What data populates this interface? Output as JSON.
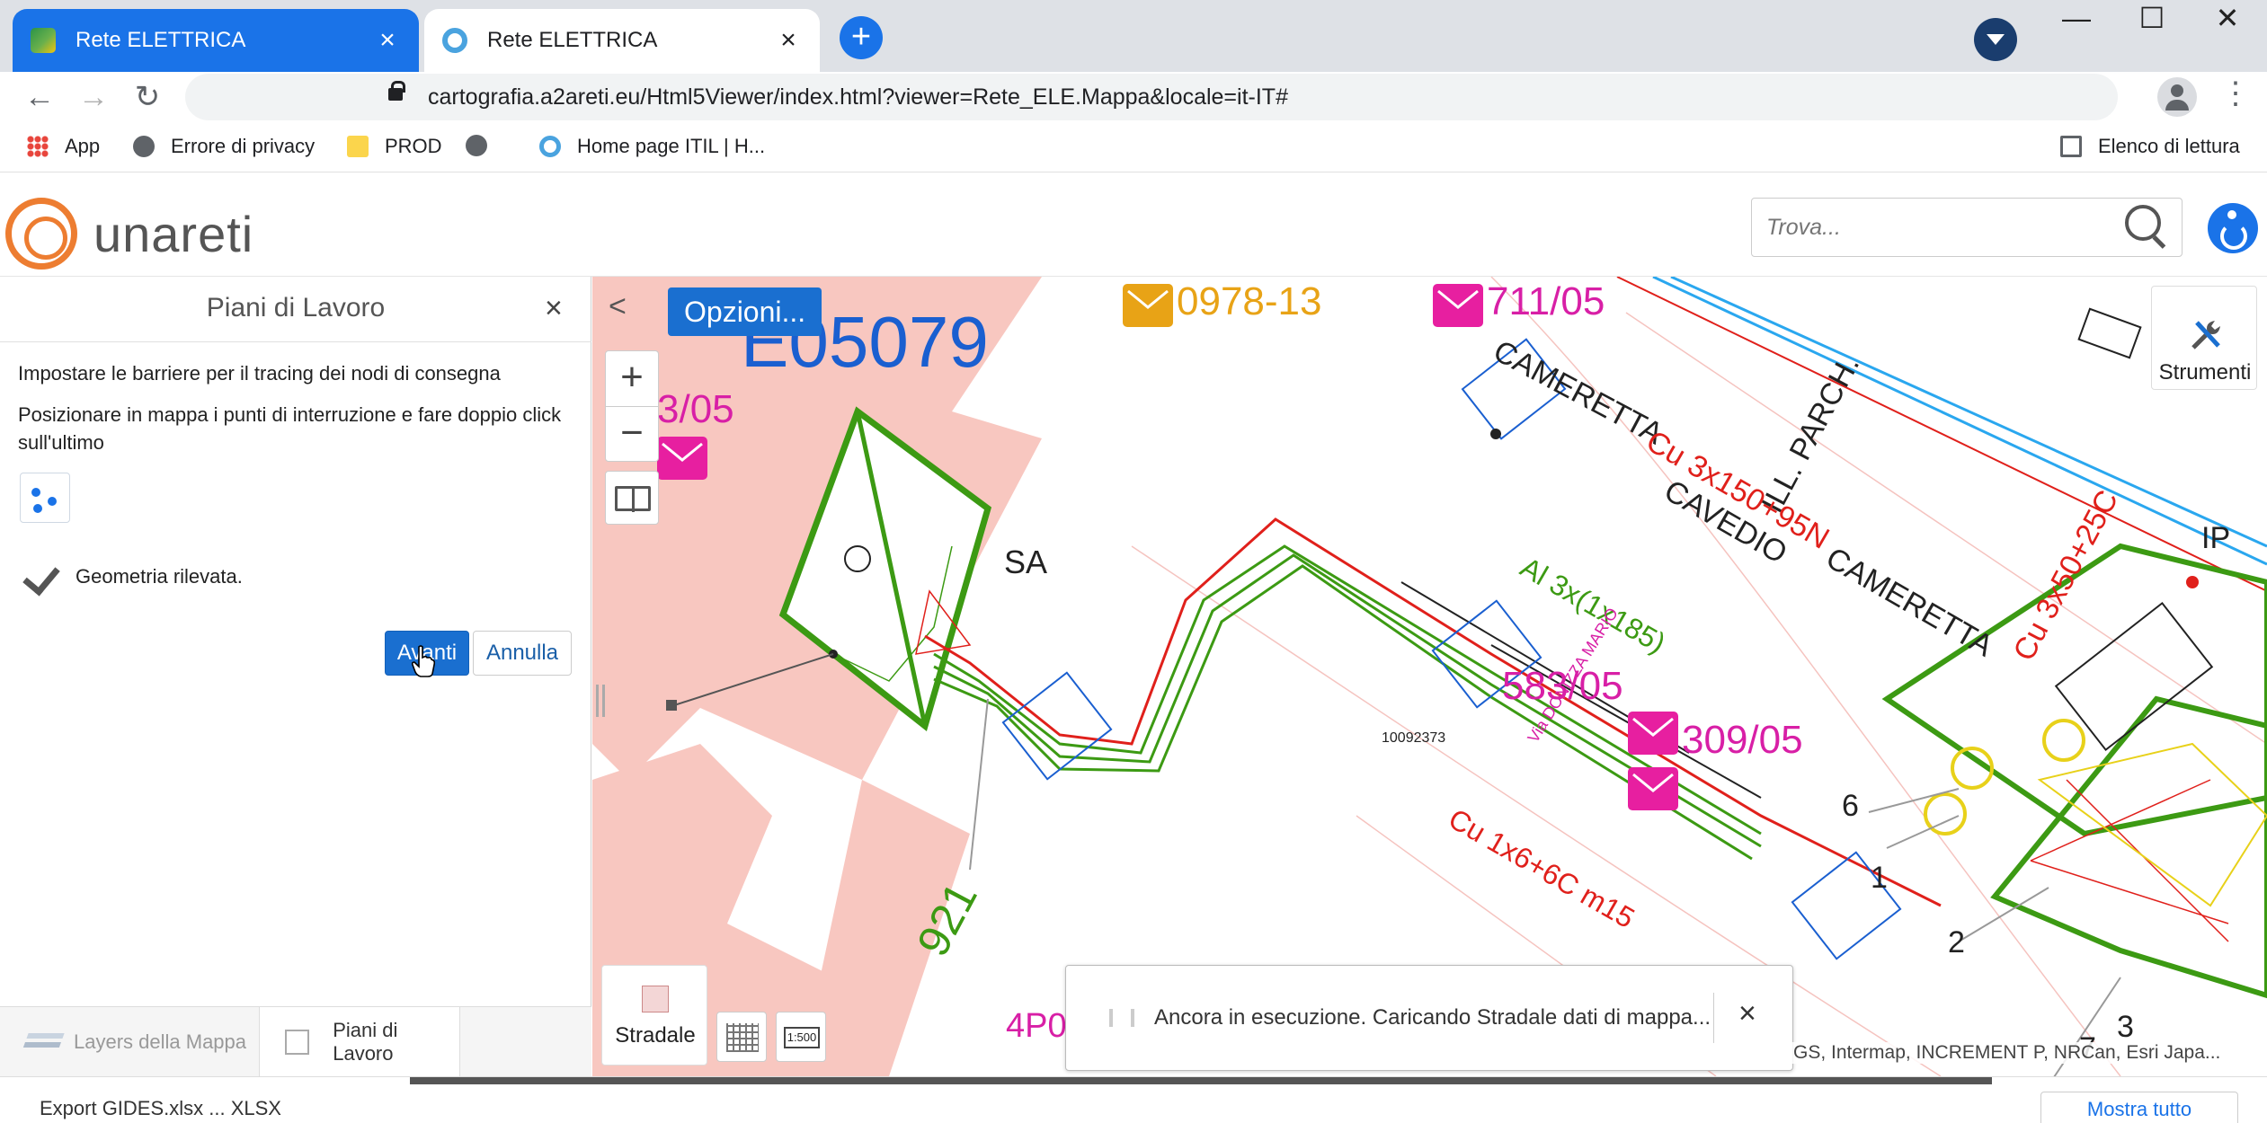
{
  "browser": {
    "tabs": [
      {
        "title": "Rete ELETTRICA",
        "active": true
      },
      {
        "title": "Rete ELETTRICA",
        "active": false
      }
    ],
    "new_tab": "+",
    "tab_close": "×",
    "window_controls": {
      "minimize": "—",
      "maximize": "☐",
      "close": "✕"
    },
    "url": "cartografia.a2areti.eu/Html5Viewer/index.html?viewer=Rete_ELE.Mappa&locale=it-IT#",
    "nav": {
      "back": "←",
      "forward": "→",
      "reload": "↻",
      "star": "☆",
      "menu": "⋮"
    },
    "bookmarks": [
      {
        "label": "App",
        "icon": "apps-icon"
      },
      {
        "label": "Errore di privacy",
        "icon": "globe-icon"
      },
      {
        "label": "PROD",
        "icon": "folder-icon"
      },
      {
        "label": "",
        "icon": "globe-icon"
      },
      {
        "label": "Home page ITIL | H...",
        "icon": "itil-icon"
      }
    ],
    "reading_list": "Elenco di lettura"
  },
  "app": {
    "logo_text": "unareti",
    "search_placeholder": "Trova..."
  },
  "panel": {
    "title": "Piani di Lavoro",
    "close": "×",
    "instruction_1": "Impostare le barriere per il tracing dei nodi di consegna",
    "instruction_2": "Posizionare in mappa i punti di interruzione e fare doppio click sull'ultimo",
    "status": "Geometria rilevata.",
    "next_label": "Avanti",
    "cancel_label": "Annulla",
    "tabs": [
      {
        "label": "Layers della Mappa",
        "active": false
      },
      {
        "label": "Piani di Lavoro",
        "active": true
      }
    ]
  },
  "map": {
    "collapse": "<",
    "options_label": "Opzioni...",
    "zoom_in": "+",
    "zoom_out": "−",
    "tools_label": "Strumenti",
    "basemap_label": "Stradale",
    "scale_label": "1:500",
    "toast_message": "Ancora in esecuzione. Caricando Stradale dati di mappa...",
    "toast_close": "×",
    "attribution": "GS, Intermap, INCREMENT P, NRCan, Esri Japa...",
    "labels": {
      "cabin_id": "E05079",
      "l1": "0978-13",
      "l2": "711/05",
      "l3": "3/05",
      "l4": "583/05",
      "l5": "309/05",
      "l6": "4P0",
      "l7": "921",
      "sa": "SA",
      "ip": "IP",
      "cameretta1": "CAMERETTA",
      "cameretta2": "CAMERETTA",
      "cavedio": "CAVEDIO",
      "ill_parch": "ILL. PARCH.",
      "cable1": "Cu 3x150+95N",
      "cable2": "Cu 3x50+25C",
      "cable3": "Al 3x(1x185)",
      "cable4": "Cu 1x6+6C m15",
      "street": "Via DONIZZA MARIO",
      "node_id": "10092373",
      "n6": "6",
      "n1": "1",
      "n2": "2",
      "n3": "3",
      "n7": "7"
    }
  },
  "downloads": {
    "item": "Export GIDES.xlsx ... XLSX",
    "show_all": "Mostra tutto"
  },
  "colors": {
    "brand_orange": "#ed7d31",
    "primary_blue": "#1a6fd0",
    "tab_active": "#1a73e8",
    "cable_red": "#e0201b",
    "cable_green": "#3c9a13",
    "label_magenta": "#d81fa6",
    "area_pink": "#f8c7c0"
  }
}
